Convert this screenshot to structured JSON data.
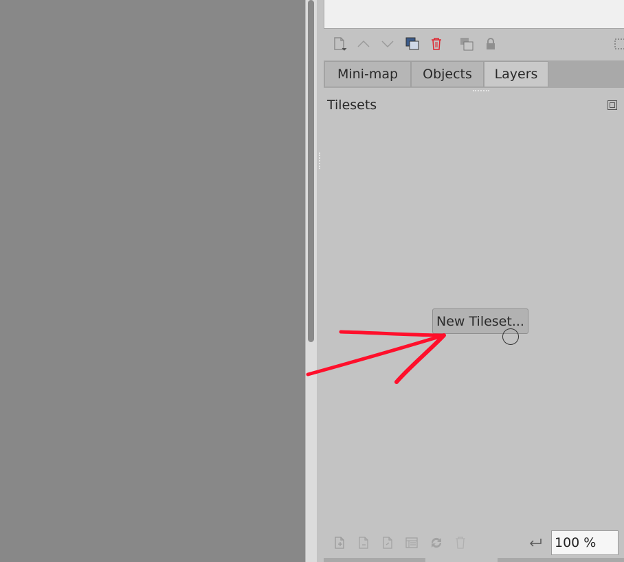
{
  "tabs": [
    {
      "label": "Mini-map"
    },
    {
      "label": "Objects"
    },
    {
      "label": "Layers",
      "active": true
    }
  ],
  "tilesets_panel": {
    "title": "Tilesets",
    "new_tileset_label": "New Tileset..."
  },
  "zoom": {
    "value": "100 %"
  },
  "layer_toolbar_icons": [
    "new-layer-icon",
    "raise-layer-icon",
    "lower-layer-icon",
    "duplicate-layer-icon",
    "delete-layer-icon",
    "merge-layer-icon",
    "lock-icon",
    "select-icon"
  ],
  "tileset_toolbar_icons": [
    "new-tileset-icon",
    "embed-tileset-icon",
    "export-tileset-icon",
    "edit-tileset-icon",
    "replace-tileset-icon",
    "remove-tileset-icon",
    "undo-icon"
  ],
  "colors": {
    "canvas": "#888888",
    "dock": "#c3c3c3",
    "annotation": "#ff0f2b"
  }
}
